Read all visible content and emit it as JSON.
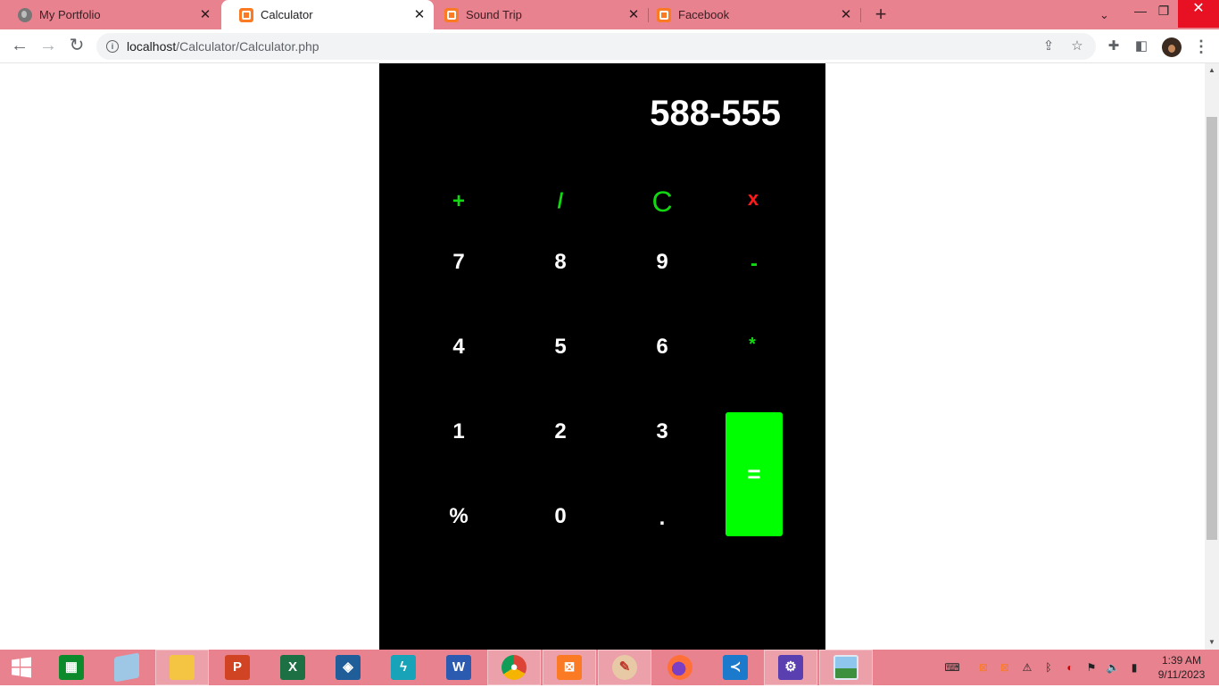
{
  "browser": {
    "tabs": [
      {
        "title": "My Portfolio",
        "favicon": "globe-icon",
        "active": false
      },
      {
        "title": "Calculator",
        "favicon": "xampp-icon",
        "active": true
      },
      {
        "title": "Sound Trip",
        "favicon": "xampp-icon",
        "active": false
      },
      {
        "title": "Facebook",
        "favicon": "xampp-icon",
        "active": false
      }
    ],
    "new_tab_symbol": "+",
    "url_host": "localhost",
    "url_path": "/Calculator/Calculator.php"
  },
  "calculator": {
    "display": "588-555",
    "keys": {
      "plus": "+",
      "divide": "/",
      "clear": "C",
      "close": "x",
      "seven": "7",
      "eight": "8",
      "nine": "9",
      "minus": "-",
      "four": "4",
      "five": "5",
      "six": "6",
      "multiply": "*",
      "one": "1",
      "two": "2",
      "three": "3",
      "equals": "=",
      "percent": "%",
      "zero": "0",
      "decimal": "."
    },
    "colors": {
      "background": "#000000",
      "digit": "#ffffff",
      "operator": "#11d811",
      "close": "#ff1a1a",
      "equals_bg": "#00ff00"
    }
  },
  "taskbar": {
    "apps": [
      {
        "name": "store-icon",
        "label": ""
      },
      {
        "name": "notepad-icon",
        "label": ""
      },
      {
        "name": "file-explorer-icon",
        "label": ""
      },
      {
        "name": "powerpoint-icon",
        "label": "P"
      },
      {
        "name": "excel-icon",
        "label": "X"
      },
      {
        "name": "virtualbox-icon",
        "label": ""
      },
      {
        "name": "power-automate-icon",
        "label": ""
      },
      {
        "name": "word-icon",
        "label": "W"
      },
      {
        "name": "chrome-icon",
        "label": ""
      },
      {
        "name": "xampp-icon",
        "label": ""
      },
      {
        "name": "paint-icon",
        "label": ""
      },
      {
        "name": "firefox-icon",
        "label": ""
      },
      {
        "name": "vscode-icon",
        "label": ""
      },
      {
        "name": "settings-icon",
        "label": ""
      },
      {
        "name": "photos-icon",
        "label": ""
      }
    ],
    "time": "1:39 AM",
    "date": "9/11/2023"
  }
}
